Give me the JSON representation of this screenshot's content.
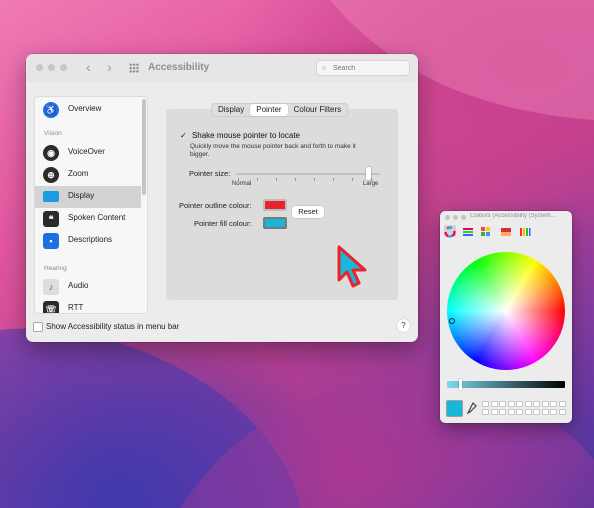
{
  "window": {
    "title": "Accessibility",
    "nav_back": "‹",
    "nav_forward": "›",
    "search_placeholder": "Search"
  },
  "sidebar": {
    "items": [
      {
        "label": "Overview",
        "icon": "accessibility-icon",
        "color": "#1e6fe0"
      },
      {
        "label": "VoiceOver",
        "icon": "voiceover-icon",
        "color": "#2b2b2b"
      },
      {
        "label": "Zoom",
        "icon": "zoom-icon",
        "color": "#2b2b2b"
      },
      {
        "label": "Display",
        "icon": "display-icon",
        "color": "#1e9be0",
        "selected": true
      },
      {
        "label": "Spoken Content",
        "icon": "spoken-content-icon",
        "color": "#2b2b2b"
      },
      {
        "label": "Descriptions",
        "icon": "descriptions-icon",
        "color": "#1e6fe0"
      },
      {
        "label": "Audio",
        "icon": "audio-icon",
        "color": "#dddddd"
      },
      {
        "label": "RTT",
        "icon": "rtt-icon",
        "color": "#2b2b2b"
      }
    ],
    "sections": {
      "vision": "Vision",
      "hearing": "Hearing"
    }
  },
  "tabs": [
    "Display",
    "Pointer",
    "Colour Filters"
  ],
  "active_tab": "Pointer",
  "pointer": {
    "shake_label": "Shake mouse pointer to locate",
    "shake_checked": true,
    "shake_desc": "Quickly move the mouse pointer back and forth to make it bigger.",
    "size_label": "Pointer size:",
    "size_min": "Normal",
    "size_max": "Large",
    "size_fraction": 0.94,
    "outline_label": "Pointer outline colour:",
    "fill_label": "Pointer fill colour:",
    "outline_color": "#e8242a",
    "fill_color": "#19b6da",
    "reset_label": "Reset"
  },
  "footer": {
    "status_label": "Show Accessibility status in menu bar",
    "help_label": "?"
  },
  "colours": {
    "title": "Colours (Accessibility (System...",
    "modes": [
      "colour-wheel-icon",
      "sliders-icon",
      "palettes-icon",
      "image-palettes-icon",
      "pencils-icon"
    ],
    "current_color": "#19b6da",
    "brightness_fraction": 0.1
  }
}
